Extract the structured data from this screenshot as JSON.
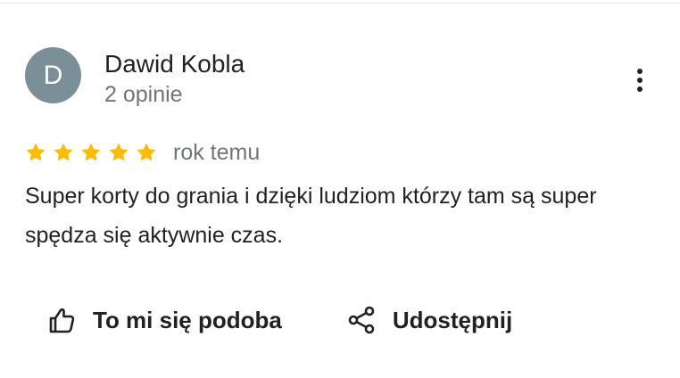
{
  "review": {
    "avatar_initial": "D",
    "author_name": "Dawid Kobla",
    "author_meta": "2 opinie",
    "rating": 5,
    "relative_time": "rok temu",
    "text": "Super korty do grania i dzięki ludziom którzy tam są super spędza się aktywnie czas."
  },
  "actions": {
    "like_label": "To mi się podoba",
    "share_label": "Udostępnij"
  },
  "icons": {
    "more": "more-vert-icon",
    "star": "star-icon",
    "like": "thumbs-up-icon",
    "share": "share-icon"
  },
  "colors": {
    "avatar_background": "#7b8f98",
    "star": "#fbbc04",
    "primary_text": "#202124",
    "secondary_text": "#70757a",
    "icon": "#202124",
    "divider": "#e3e3e3"
  }
}
